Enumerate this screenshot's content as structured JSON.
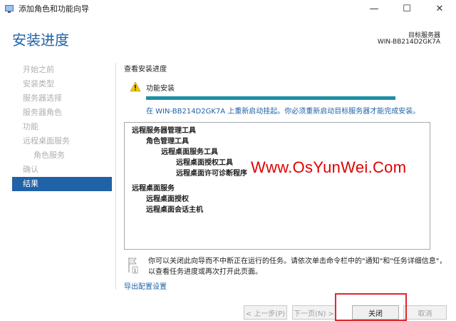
{
  "window": {
    "title": "添加角色和功能向导",
    "controls": {
      "minimize": "—",
      "maximize": "☐",
      "close": "✕"
    }
  },
  "header": {
    "page_title": "安装进度",
    "destination_label": "目标服务器",
    "destination_value": "WIN-BB214D2GK7A"
  },
  "nav": {
    "items": [
      {
        "label": "开始之前",
        "state": "disabled"
      },
      {
        "label": "安装类型",
        "state": "disabled"
      },
      {
        "label": "服务器选择",
        "state": "disabled"
      },
      {
        "label": "服务器角色",
        "state": "disabled"
      },
      {
        "label": "功能",
        "state": "disabled"
      },
      {
        "label": "远程桌面服务",
        "state": "disabled"
      },
      {
        "label": "角色服务",
        "state": "disabled"
      },
      {
        "label": "确认",
        "state": "disabled"
      },
      {
        "label": "结果",
        "state": "active"
      }
    ]
  },
  "content": {
    "section_title": "查看安装进度",
    "install_label": "功能安装",
    "progress_fraction": 1.0,
    "status_text": "在 WIN-BB214D2GK7A 上重新启动挂起。你必须重新启动目标服务器才能完成安装。",
    "results": [
      {
        "label": "远程服务器管理工具",
        "level": 0
      },
      {
        "label": "角色管理工具",
        "level": 1
      },
      {
        "label": "远程桌面服务工具",
        "level": 2
      },
      {
        "label": "远程桌面授权工具",
        "level": 3
      },
      {
        "label": "远程桌面许可诊断程序",
        "level": 3
      },
      {
        "label": "远程桌面服务",
        "level": 0
      },
      {
        "label": "远程桌面授权",
        "level": 1
      },
      {
        "label": "远程桌面会话主机",
        "level": 1
      }
    ],
    "info_text": "你可以关闭此向导而不中断正在运行的任务。请依次单击命令栏中的\"通知\"和\"任务详细信息\"，以查看任务进度或再次打开此页面。",
    "export_link": "导出配置设置"
  },
  "watermark": "Www.OsYunWei.Com",
  "footer": {
    "prev": "< 上一步(P)",
    "next": "下一页(N) >",
    "close": "关闭",
    "cancel": "取消"
  },
  "colors": {
    "accent": "#1f62a6",
    "progress": "#1f8fa4",
    "highlight": "#e3262e",
    "watermark": "#e00000"
  }
}
